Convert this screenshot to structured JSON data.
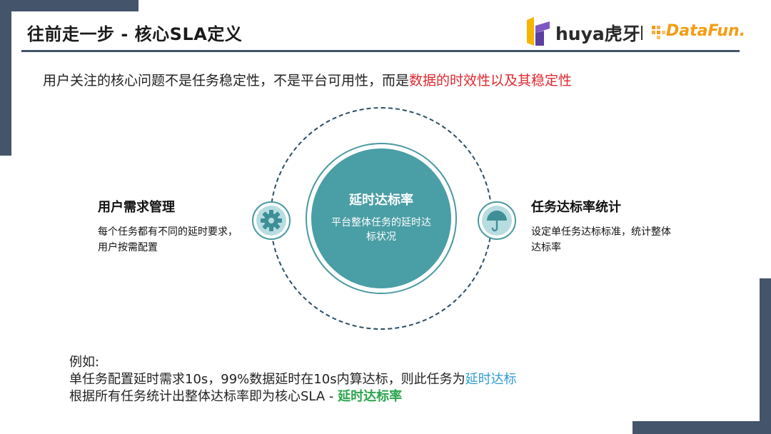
{
  "header": {
    "title": "往前走一步 - 核心SLA定义",
    "huya_logo_text": "huya虎牙",
    "logo_separator": "|",
    "datafun_logo_text": "DataFun."
  },
  "intro": {
    "prefix": "用户关注的核心问题不是任务稳定性，不是平台可用性，而是",
    "highlight": "数据的时效性以及其稳定性",
    "highlight_color": "#e0282e"
  },
  "center": {
    "title": "延时达标率",
    "desc": "平台整体任务的延时达标状况",
    "color": "#4a9ea5"
  },
  "left_node": {
    "icon": "gear-icon",
    "title": "用户需求管理",
    "desc": "每个任务都有不同的延时要求，用户按需配置"
  },
  "right_node": {
    "icon": "umbrella-icon",
    "title": "任务达标率统计",
    "desc": "设定单任务达标标准，统计整体达标率"
  },
  "example": {
    "label": "例如:",
    "line1_prefix": "单任务配置延时需求10s，99%数据延时在10s内算达标，则此任务为",
    "line1_highlight": "延时达标",
    "line2_prefix": "根据所有任务统计出整体达标率即为核心SLA - ",
    "line2_highlight": "延时达标率",
    "blue_color": "#2e9bd6",
    "green_color": "#2aa54d"
  },
  "colors": {
    "slate": "#44546a",
    "teal": "#4a9ea5"
  }
}
